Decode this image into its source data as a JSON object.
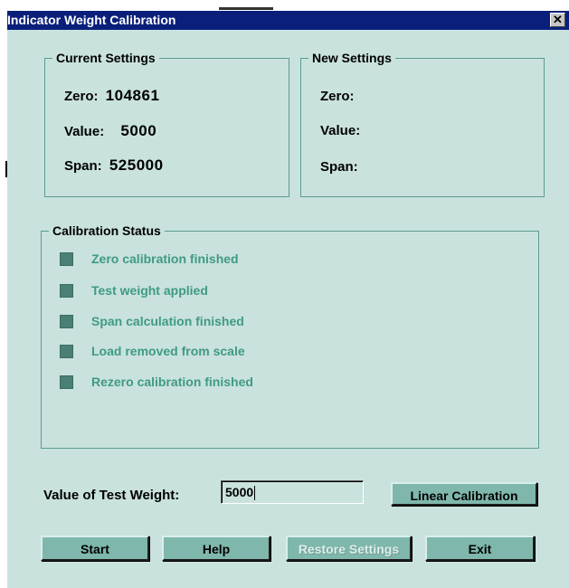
{
  "window": {
    "title": "Indicator Weight Calibration",
    "close_glyph": "✕"
  },
  "current_settings": {
    "label": "Current Settings",
    "zero_label": "Zero:",
    "zero_value": "104861",
    "value_label": "Value:",
    "value_value": "5000",
    "span_label": "Span:",
    "span_value": "525000"
  },
  "new_settings": {
    "label": "New Settings",
    "zero_label": "Zero:",
    "value_label": "Value:",
    "span_label": "Span:"
  },
  "calibration_status": {
    "label": "Calibration Status",
    "items": [
      "Zero calibration finished",
      "Test weight applied",
      "Span calculation finished",
      "Load removed from scale",
      "Rezero calibration finished"
    ]
  },
  "test_weight": {
    "label": "Value of Test Weight:",
    "value": "5000"
  },
  "buttons": {
    "linear_calibration": "Linear Calibration",
    "start": "Start",
    "help": "Help",
    "restore_settings": "Restore Settings",
    "exit": "Exit"
  },
  "colors": {
    "window_bg": "#c9e2de",
    "titlebar": "#0a1f7a",
    "button": "#7fb7ac",
    "status_text": "#3f9a84"
  }
}
